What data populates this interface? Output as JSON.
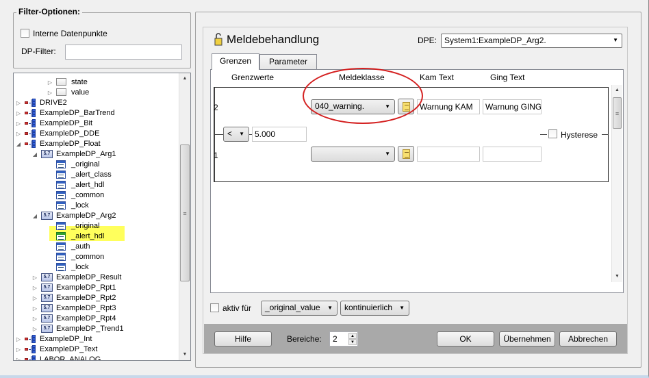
{
  "filter": {
    "group_title": "Filter-Optionen:",
    "internal_dp_label": "Interne Datenpunkte",
    "dp_filter_label": "DP-Filter:",
    "dp_filter_value": ""
  },
  "tree": {
    "items": [
      {
        "label": "state",
        "icon": "folder-icon"
      },
      {
        "label": "value",
        "icon": "folder-icon"
      },
      {
        "label": "DRIVE2",
        "icon": "datapoint-icon"
      },
      {
        "label": "ExampleDP_BarTrend",
        "icon": "datapoint-icon"
      },
      {
        "label": "ExampleDP_Bit",
        "icon": "datapoint-icon"
      },
      {
        "label": "ExampleDP_DDE",
        "icon": "datapoint-icon"
      },
      {
        "label": "ExampleDP_Float",
        "icon": "datapoint-icon"
      },
      {
        "label": "ExampleDP_Arg1",
        "icon": "float-element-icon"
      },
      {
        "label": "_original",
        "icon": "config-icon"
      },
      {
        "label": "_alert_class",
        "icon": "config-icon"
      },
      {
        "label": "_alert_hdl",
        "icon": "config-icon"
      },
      {
        "label": "_common",
        "icon": "config-icon"
      },
      {
        "label": "_lock",
        "icon": "config-icon"
      },
      {
        "label": "ExampleDP_Arg2",
        "icon": "float-element-icon"
      },
      {
        "label": "_original",
        "icon": "config-icon"
      },
      {
        "label": "_alert_hdl",
        "icon": "config-icon"
      },
      {
        "label": "_auth",
        "icon": "config-icon"
      },
      {
        "label": "_common",
        "icon": "config-icon"
      },
      {
        "label": "_lock",
        "icon": "config-icon"
      },
      {
        "label": "ExampleDP_Result",
        "icon": "float-element-icon"
      },
      {
        "label": "ExampleDP_Rpt1",
        "icon": "float-element-icon"
      },
      {
        "label": "ExampleDP_Rpt2",
        "icon": "float-element-icon"
      },
      {
        "label": "ExampleDP_Rpt3",
        "icon": "float-element-icon"
      },
      {
        "label": "ExampleDP_Rpt4",
        "icon": "float-element-icon"
      },
      {
        "label": "ExampleDP_Trend1",
        "icon": "float-element-icon"
      },
      {
        "label": "ExampleDP_Int",
        "icon": "datapoint-icon"
      },
      {
        "label": "ExampleDP_Text",
        "icon": "datapoint-icon"
      },
      {
        "label": "LABOR_ANALOG",
        "icon": "datapoint-icon"
      }
    ],
    "float_element_glyph": "5.7"
  },
  "panel": {
    "title": "Meldebehandlung",
    "dpe_label": "DPE:",
    "dpe_value": "System1:ExampleDP_Arg2.",
    "tabs": [
      {
        "label": "Grenzen"
      },
      {
        "label": "Parameter"
      }
    ],
    "columns": {
      "limits": "Grenzwerte",
      "alert_class": "Meldeklasse",
      "came_text": "Kam Text",
      "went_text": "Ging Text"
    },
    "range2": {
      "index": "2",
      "alert_class": "040_warning.",
      "came_text": "Warnung KAM",
      "went_text": "Warnung GING"
    },
    "limit": {
      "operator": "<",
      "value": "5.000",
      "hysteresis_label": "Hysterese"
    },
    "range1": {
      "index": "1",
      "alert_class": "",
      "came_text": "",
      "went_text": ""
    },
    "active_for_label": "aktiv für",
    "active_for_value": "_original_value",
    "mode_value": "kontinuierlich"
  },
  "footer": {
    "help": "Hilfe",
    "ranges_label": "Bereiche:",
    "ranges_value": "2",
    "ok": "OK",
    "apply": "Übernehmen",
    "cancel": "Abbrechen"
  },
  "colors": {
    "highlight": "#ffff40",
    "annotation": "#d42020",
    "footer_bar": "#a9a9a9"
  }
}
